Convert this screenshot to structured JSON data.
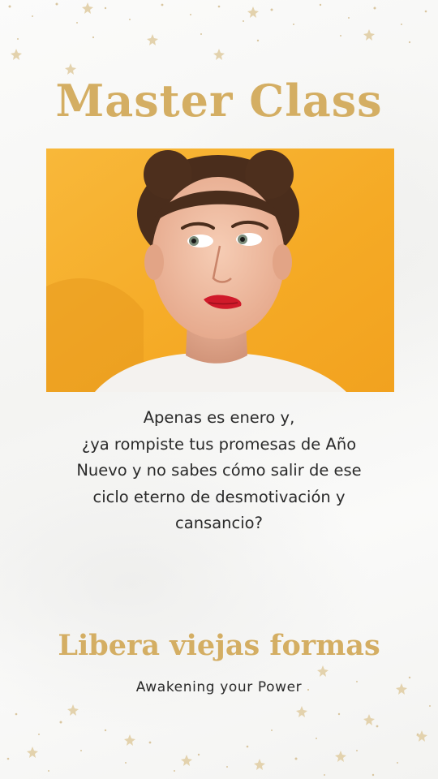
{
  "header": {
    "title": "Master Class"
  },
  "photo": {
    "subject": "woman-biting-lip-icon",
    "background_color": "#f6b02e"
  },
  "body": {
    "lines": [
      "Apenas es enero y,",
      "¿ya rompiste tus promesas de Año",
      "Nuevo y no sabes cómo salir de ese",
      "ciclo eterno de desmotivación y",
      "cansancio?"
    ]
  },
  "footer": {
    "headline": "Libera viejas formas",
    "tagline": "Awakening your Power"
  },
  "colors": {
    "accent_gold": "#d4ae63",
    "text_dark": "#2a2a2a",
    "background": "#f9f9f8"
  }
}
